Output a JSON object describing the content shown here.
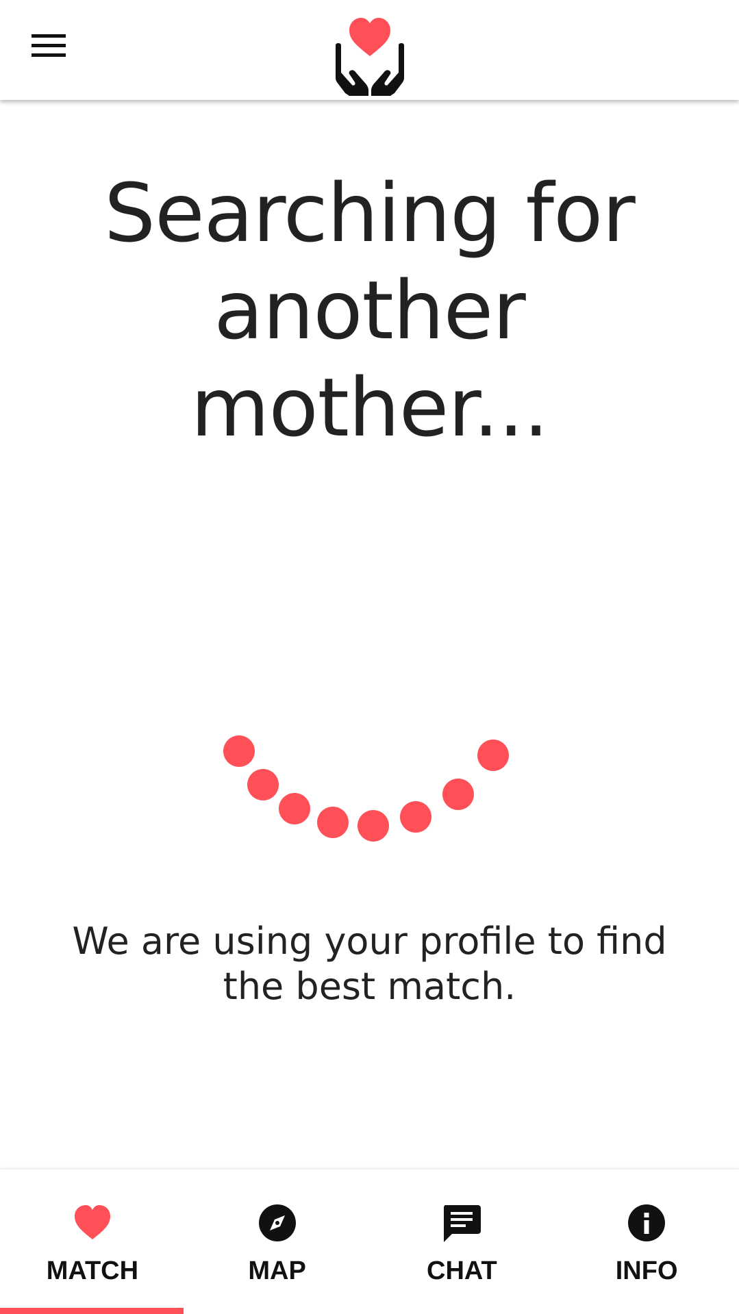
{
  "colors": {
    "accent": "#FF5058",
    "text": "#222222",
    "icon": "#111111",
    "background": "#FFFFFF"
  },
  "header": {
    "menu_icon": "hamburger-menu-icon",
    "logo_icon": "heart-in-hands-logo"
  },
  "main": {
    "title": "Searching for another mother...",
    "loading_icon": "dotted-arc-spinner",
    "subtitle": "We are using your profile to find the best match."
  },
  "bottom_nav": {
    "active": "match",
    "items": [
      {
        "id": "match",
        "label": "MATCH",
        "icon": "heart-icon"
      },
      {
        "id": "map",
        "label": "MAP",
        "icon": "compass-icon"
      },
      {
        "id": "chat",
        "label": "CHAT",
        "icon": "chat-bubble-icon"
      },
      {
        "id": "info",
        "label": "INFO",
        "icon": "info-icon"
      }
    ]
  }
}
